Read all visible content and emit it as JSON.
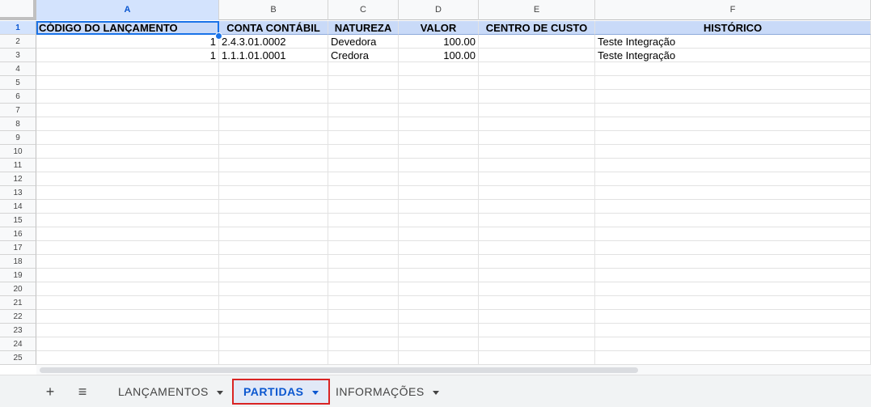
{
  "columns": [
    "A",
    "B",
    "C",
    "D",
    "E",
    "F"
  ],
  "row_numbers": [
    "1",
    "2",
    "3",
    "4",
    "5",
    "6",
    "7",
    "8",
    "9",
    "10",
    "11",
    "12",
    "13",
    "14",
    "15",
    "16",
    "17",
    "18",
    "19",
    "20",
    "21",
    "22",
    "23",
    "24",
    "25"
  ],
  "headers": [
    "CÓDIGO DO LANÇAMENTO",
    "CONTA CONTÁBIL",
    "NATUREZA",
    "VALOR",
    "CENTRO DE CUSTO",
    "HISTÓRICO"
  ],
  "rows": [
    [
      "1",
      "2.4.3.01.0002",
      "Devedora",
      "100.00",
      "",
      "Teste Integração"
    ],
    [
      "1",
      "1.1.1.01.0001",
      "Credora",
      "100.00",
      "",
      "Teste Integração"
    ]
  ],
  "sheet_tabs": {
    "add_icon": "+",
    "menu_icon": "≡",
    "tabs": [
      {
        "label": "LANÇAMENTOS",
        "active": false
      },
      {
        "label": "PARTIDAS",
        "active": true
      },
      {
        "label": "INFORMAÇÕES",
        "active": false
      }
    ]
  },
  "colors": {
    "header_fill": "#c9daf8",
    "selection": "#1a73e8",
    "active_tab_outline": "#d92424",
    "active_tab_text": "#0b57d0"
  }
}
